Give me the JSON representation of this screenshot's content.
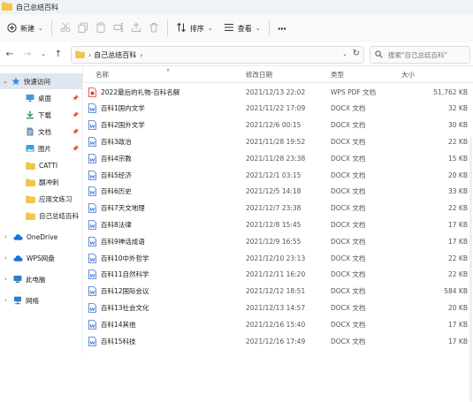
{
  "window": {
    "title": "自己总结百科"
  },
  "toolbar": {
    "new_label": "新建",
    "sort_label": "排序",
    "view_label": "查看",
    "more_label": "···"
  },
  "address": {
    "crumb": "自己总结百科",
    "search_placeholder": "搜索\"自己总结百科\""
  },
  "sidebar": {
    "items": [
      {
        "label": "快速访问",
        "icon": "star-icon"
      },
      {
        "label": "桌面",
        "icon": "desktop-icon"
      },
      {
        "label": "下载",
        "icon": "download-icon"
      },
      {
        "label": "文档",
        "icon": "document-icon"
      },
      {
        "label": "图片",
        "icon": "picture-icon"
      },
      {
        "label": "CATTI",
        "icon": "folder-icon"
      },
      {
        "label": "翻冲刺",
        "icon": "folder-icon"
      },
      {
        "label": "应用文练习",
        "icon": "folder-icon"
      },
      {
        "label": "自己总结百科",
        "icon": "folder-icon"
      },
      {
        "label": "OneDrive",
        "icon": "cloud-icon"
      },
      {
        "label": "WPS网盘",
        "icon": "cloud-icon"
      },
      {
        "label": "此电脑",
        "icon": "computer-icon"
      },
      {
        "label": "网络",
        "icon": "network-icon"
      }
    ]
  },
  "columns": {
    "name": "名称",
    "date": "修改日期",
    "type": "类型",
    "size": "大小"
  },
  "files": [
    {
      "name": "2022最后的礼物-百科名解",
      "date": "2021/12/13 22:02",
      "type": "WPS PDF 文档",
      "size": "51,762 KB",
      "icon": "pdf-icon"
    },
    {
      "name": "百科1国内文学",
      "date": "2021/11/22 17:09",
      "type": "DOCX 文档",
      "size": "32 KB",
      "icon": "docx-icon"
    },
    {
      "name": "百科2国外文学",
      "date": "2021/12/6 00:15",
      "type": "DOCX 文档",
      "size": "30 KB",
      "icon": "docx-icon"
    },
    {
      "name": "百科3政治",
      "date": "2021/11/28 19:52",
      "type": "DOCX 文档",
      "size": "22 KB",
      "icon": "docx-icon"
    },
    {
      "name": "百科4宗教",
      "date": "2021/11/28 23:38",
      "type": "DOCX 文档",
      "size": "15 KB",
      "icon": "docx-icon"
    },
    {
      "name": "百科5经济",
      "date": "2021/12/1 03:15",
      "type": "DOCX 文档",
      "size": "20 KB",
      "icon": "docx-icon"
    },
    {
      "name": "百科6历史",
      "date": "2021/12/5 14:18",
      "type": "DOCX 文档",
      "size": "33 KB",
      "icon": "docx-icon"
    },
    {
      "name": "百科7天文地理",
      "date": "2021/12/7 23:38",
      "type": "DOCX 文档",
      "size": "22 KB",
      "icon": "docx-icon"
    },
    {
      "name": "百科8法律",
      "date": "2021/12/8 15:45",
      "type": "DOCX 文档",
      "size": "17 KB",
      "icon": "docx-icon"
    },
    {
      "name": "百科9神话成语",
      "date": "2021/12/9 16:55",
      "type": "DOCX 文档",
      "size": "17 KB",
      "icon": "docx-icon"
    },
    {
      "name": "百科10中外哲学",
      "date": "2021/12/10 23:13",
      "type": "DOCX 文档",
      "size": "22 KB",
      "icon": "docx-icon"
    },
    {
      "name": "百科11自然科学",
      "date": "2021/12/11 16:20",
      "type": "DOCX 文档",
      "size": "22 KB",
      "icon": "docx-icon"
    },
    {
      "name": "百科12国际会议",
      "date": "2021/12/12 18:51",
      "type": "DOCX 文档",
      "size": "584 KB",
      "icon": "docx-icon"
    },
    {
      "name": "百科13社会文化",
      "date": "2021/12/13 14:57",
      "type": "DOCX 文档",
      "size": "20 KB",
      "icon": "docx-icon"
    },
    {
      "name": "百科14其他",
      "date": "2021/12/16 15:40",
      "type": "DOCX 文档",
      "size": "17 KB",
      "icon": "docx-icon"
    },
    {
      "name": "百科15科技",
      "date": "2021/12/16 17:49",
      "type": "DOCX 文档",
      "size": "17 KB",
      "icon": "docx-icon"
    }
  ]
}
